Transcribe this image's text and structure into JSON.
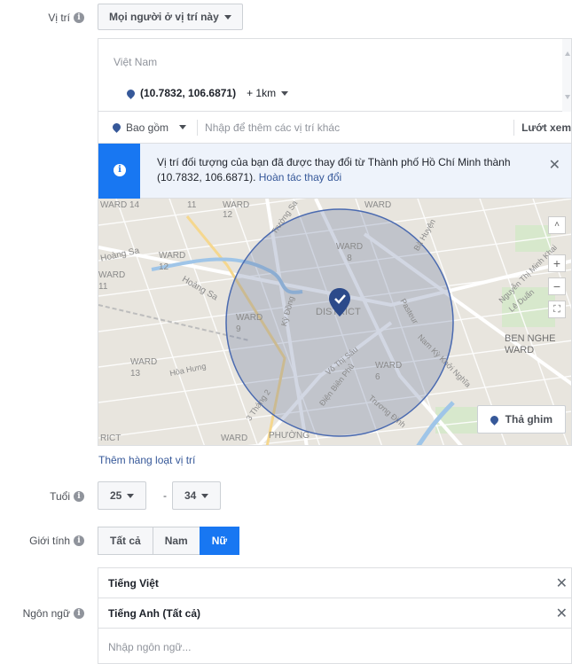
{
  "location": {
    "label": "Vị trí",
    "audience_dropdown": "Mọi người ở vị trí này",
    "country": "Việt Nam",
    "coordinate": "(10.7832, 106.6871)",
    "radius": "+ 1km",
    "include_dropdown": "Bao gồm",
    "add_placeholder": "Nhập để thêm các vị trí khác",
    "browse": "Lướt xem",
    "notice_text": "Vị trí đối tượng của bạn đã được thay đổi từ Thành phố Hồ Chí Minh thành (10.7832, 106.6871).",
    "notice_link": "Hoàn tác thay đổi",
    "drop_pin": "Thả ghim",
    "bulk_link": "Thêm hàng loạt vị trí",
    "map_labels": {
      "ward14": "WARD 14",
      "ward11_top": "11",
      "ward12_top": "WARD 12",
      "ward_top_right": "WARD",
      "hoang_sa_left": "Hoàng Sa",
      "ward12_left": "WARD 12",
      "ward11_left": "WARD 11",
      "ward8": "WARD 8",
      "hoang_sa_mid": "Hoàng Sa",
      "ward9": "WARD 9",
      "district": "DISTRICT",
      "ward13": "WARD 13",
      "ward6": "WARD 6",
      "ben_nghe": "BEN NGHE WARD",
      "phuong": "PHƯỜNG",
      "ward_bottom": "WARD",
      "rict": "RICT",
      "vo_thi_sau": "Võ Thị Sáu",
      "pasteur": "Pasteur",
      "dien_bien_phu": "Điện Biên Phủ",
      "ky_dong": "Kỳ Đồng",
      "hoa_hung": "Hòa Hưng",
      "truong_sa": "Trường Sa",
      "nam_ky_khoi_nghia": "Nam Kỳ Khởi Nghĩa",
      "truong_dinh": "Trương Định",
      "thang_2": "3 Tháng 2",
      "nguyen_thi_minh_khai": "Nguyễn Thị Minh Khai",
      "le_duan": "Lê Duẩn",
      "ba_huyen": "Bà Huyện"
    }
  },
  "age": {
    "label": "Tuổi",
    "min": "25",
    "separator": "-",
    "max": "34"
  },
  "gender": {
    "label": "Giới tính",
    "options": [
      "Tất cả",
      "Nam",
      "Nữ"
    ],
    "selected": "Nữ"
  },
  "language": {
    "label": "Ngôn ngữ",
    "items": [
      "Tiếng Việt",
      "Tiếng Anh (Tất cả)"
    ],
    "placeholder": "Nhập ngôn ngữ..."
  },
  "icons": {
    "info": "info-icon",
    "pin": "map-pin-icon",
    "close": "close-icon",
    "caret": "caret-down-icon",
    "zoom_in": "zoom-in-icon",
    "zoom_out": "zoom-out-icon",
    "recenter": "recenter-icon"
  },
  "colors": {
    "accent": "#1877f2",
    "link": "#365899",
    "pin": "#365899"
  }
}
